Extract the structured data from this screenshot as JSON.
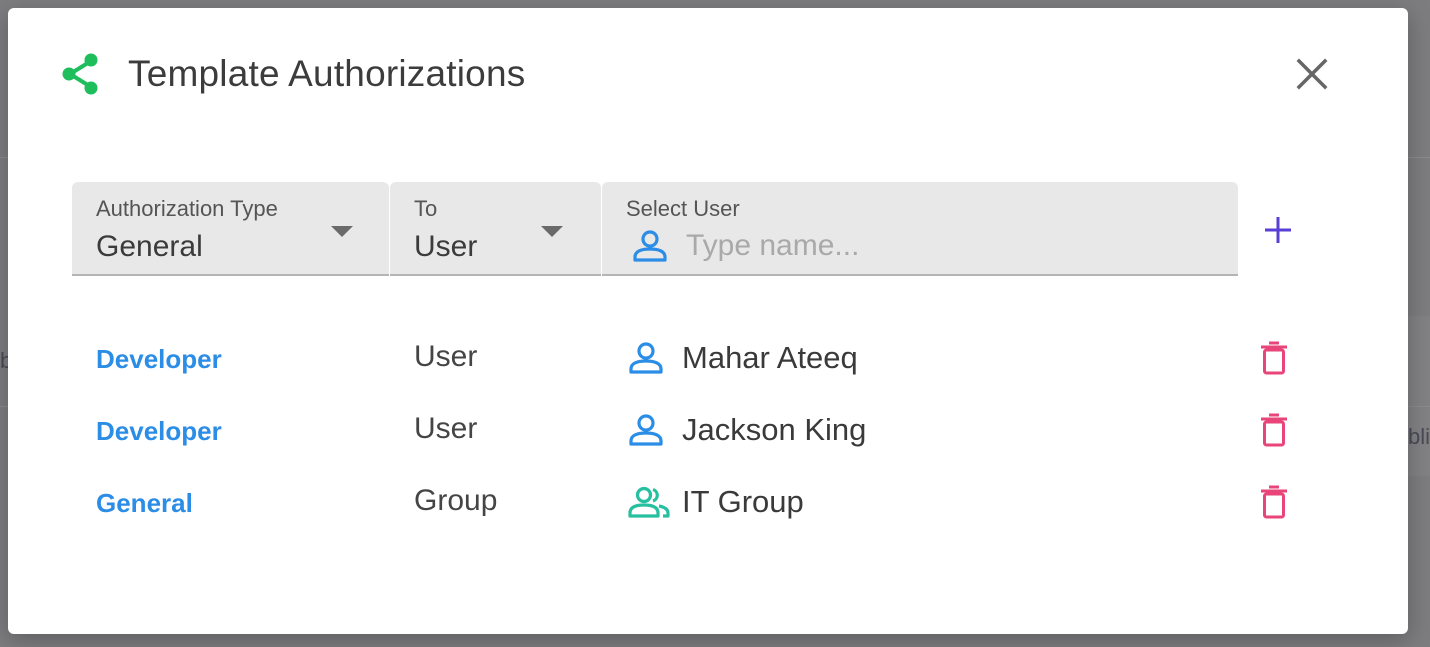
{
  "background": {
    "edge_text_1": "b",
    "edge_text_2": "bli"
  },
  "dialog": {
    "title": "Template Authorizations",
    "title_icon": "share-icon",
    "close_icon": "close-icon"
  },
  "filters": {
    "authorization_type": {
      "label": "Authorization Type",
      "value": "General"
    },
    "to": {
      "label": "To",
      "value": "User"
    },
    "select_user": {
      "label": "Select User",
      "value": "",
      "placeholder": "Type name...",
      "icon": "user-icon"
    },
    "add_icon": "plus-icon"
  },
  "authorizations": [
    {
      "type": "Developer",
      "to": "User",
      "name": "Mahar Ateeq",
      "icon": "user-icon"
    },
    {
      "type": "Developer",
      "to": "User",
      "name": "Jackson King",
      "icon": "user-icon"
    },
    {
      "type": "General",
      "to": "Group",
      "name": "IT Group",
      "icon": "group-icon"
    }
  ],
  "colors": {
    "accent_green": "#1fbe5c",
    "link_blue": "#2b8de6",
    "user_icon_blue": "#2b8de6",
    "group_icon_teal": "#26c0a0",
    "delete_pink": "#e8457a",
    "add_purple": "#5a3fd6"
  }
}
